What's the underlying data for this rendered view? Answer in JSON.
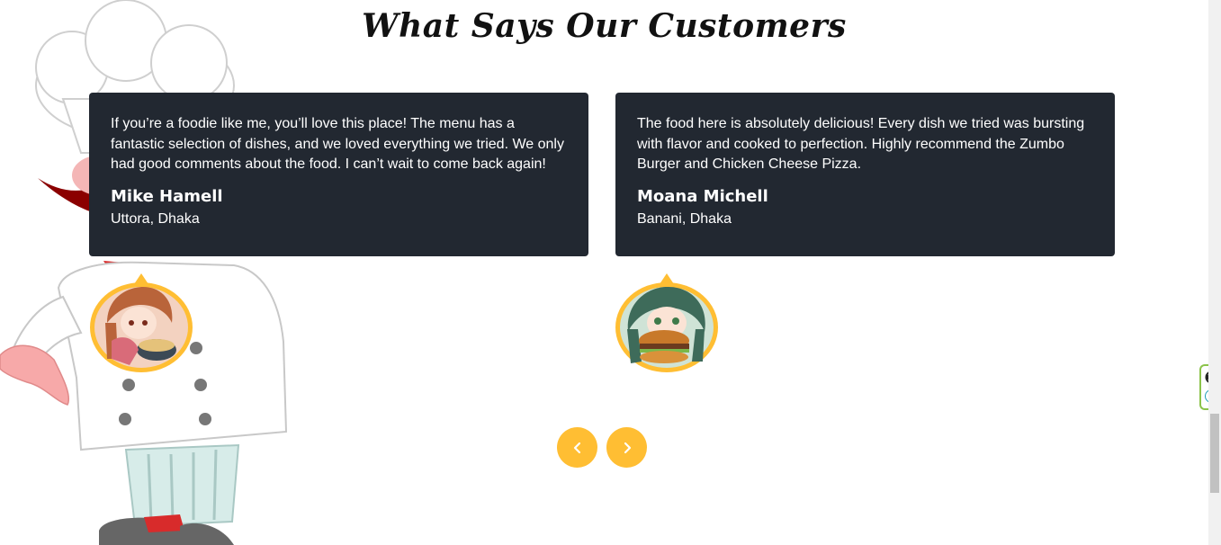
{
  "section": {
    "title": "What Says Our Customers"
  },
  "testimonials": [
    {
      "quote": "If you’re a foodie like me, you’ll love this place! The menu has a fantastic selection of dishes, and we loved everything we tried. We only had good comments about the food. I can’t wait to come back again!",
      "name": "Mike Hamell",
      "location": "Uttora, Dhaka"
    },
    {
      "quote": "The food here is absolutely delicious! Every dish we tried was bursting with flavor and cooked to perfection. Highly recommend the Zumbo Burger and Chicken Cheese Pizza.",
      "name": "Moana Michell",
      "location": "Banani, Dhaka"
    }
  ],
  "carousel": {
    "prev_icon": "chevron-left-icon",
    "next_icon": "chevron-right-icon"
  },
  "extension": {
    "close_icon": "close-icon",
    "badge": "e"
  },
  "colors": {
    "accent": "#ffbe33",
    "card_bg": "#222831",
    "text_light": "#ffffff"
  }
}
